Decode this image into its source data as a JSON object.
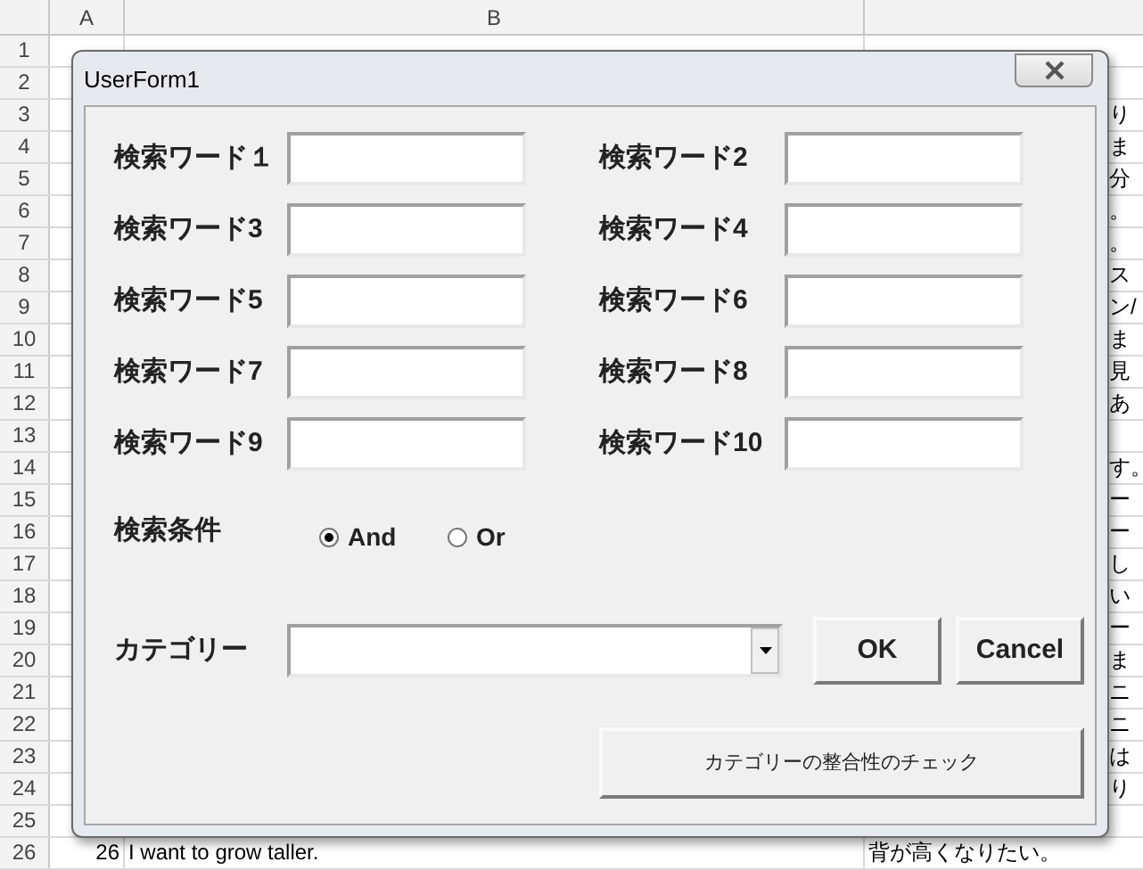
{
  "sheet": {
    "columns": [
      "A",
      "B"
    ],
    "rows": [
      {
        "number": "1"
      },
      {
        "number": "2"
      },
      {
        "number": "3",
        "col_c": "り"
      },
      {
        "number": "4",
        "col_c": "ま"
      },
      {
        "number": "5",
        "col_c": "分"
      },
      {
        "number": "6",
        "col_c": "。"
      },
      {
        "number": "7",
        "col_c": "。"
      },
      {
        "number": "8",
        "col_c": "ス"
      },
      {
        "number": "9",
        "col_c": "ン/"
      },
      {
        "number": "10",
        "col_c": "ま"
      },
      {
        "number": "11",
        "col_c": "見"
      },
      {
        "number": "12",
        "col_c": "あ"
      },
      {
        "number": "13"
      },
      {
        "number": "14",
        "col_c": "す。"
      },
      {
        "number": "15",
        "col_c": "ー"
      },
      {
        "number": "16",
        "col_c": "ー"
      },
      {
        "number": "17",
        "col_c": "し"
      },
      {
        "number": "18",
        "col_c": "い"
      },
      {
        "number": "19",
        "col_c": "ー"
      },
      {
        "number": "20",
        "col_c": "ま"
      },
      {
        "number": "21",
        "col_c": "ニ"
      },
      {
        "number": "22",
        "col_c": "ニ"
      },
      {
        "number": "23",
        "col_c": "は"
      },
      {
        "number": "24",
        "col_c": "り"
      },
      {
        "number": "25"
      },
      {
        "number": "26",
        "col_a": "26",
        "col_b": "I want to grow taller.",
        "col_c": "背が高くなりたい。"
      }
    ]
  },
  "dialog": {
    "title": "UserForm1",
    "fields": [
      {
        "label": "検索ワード１"
      },
      {
        "label": "検索ワード2"
      },
      {
        "label": "検索ワード3"
      },
      {
        "label": "検索ワード4"
      },
      {
        "label": "検索ワード5"
      },
      {
        "label": "検索ワード6"
      },
      {
        "label": "検索ワード7"
      },
      {
        "label": "検索ワード8"
      },
      {
        "label": "検索ワード9"
      },
      {
        "label": "検索ワード10"
      }
    ],
    "condition": {
      "label": "検索条件",
      "options": [
        {
          "label": "And",
          "selected": true
        },
        {
          "label": "Or",
          "selected": false
        }
      ]
    },
    "category": {
      "label": "カテゴリー"
    },
    "buttons": [
      "OK",
      "Cancel"
    ],
    "check_button": "カテゴリーの整合性のチェック"
  }
}
